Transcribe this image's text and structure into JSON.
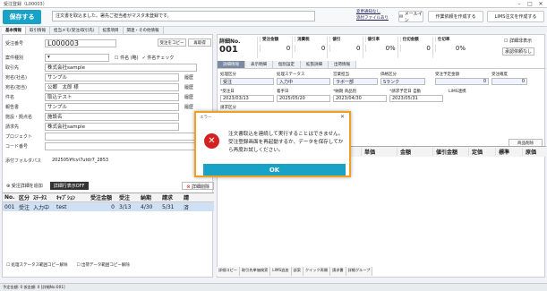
{
  "window": {
    "title": "受注登録（L00003）",
    "min": "–",
    "max": "□",
    "close": "✕"
  },
  "toolbar": {
    "save_label": "保存する",
    "message": "注文書を取込ました。署先ご担当者がマスタ未登録です。",
    "link1": "変更通知なし",
    "link2": "添付ファイルあり",
    "mail_label": "メールイン",
    "btn_create_work": "作業依頼を作成する",
    "btn_create_lims": "LIMS注文を作成する"
  },
  "main_tabs": [
    "基本情報",
    "取引情報",
    "担当メモ(受注/取引先)",
    "拡張項目",
    "関連・その他情報"
  ],
  "form": {
    "order_no_label": "受注番号",
    "order_no": "L000003",
    "copy_btn": "受注をコピー",
    "reissue_btn": "再取得",
    "case_label": "案件種別",
    "name_check": "件名 (略)",
    "name_btn": "件名チェック",
    "customer_label": "取引先",
    "customer_value": "株式会社sample",
    "attn_label": "宛名(社名)",
    "attn_value": "サンプル",
    "person_label": "宛名(担当)",
    "person_value": "公郷　太郎 様",
    "history": "履歴",
    "subject_label": "件名",
    "subject_value": "取込テスト",
    "report_label": "報告書",
    "report_value": "サンプル",
    "facility_label": "施設・拠点名",
    "facility_value": "施設名",
    "billing_label": "請求先",
    "billing_value": "株式会社sample",
    "project_label": "プロジェクト",
    "code_label": "コード番号",
    "attach_label": "添付フォルダパス",
    "attach_value": "202505¥fcvi7utdr7_2853"
  },
  "left_tabs": {
    "add": "受注詳細を追加",
    "show_off": "詳細行表示OFF",
    "delete": "詳細削除"
  },
  "left_grid": {
    "headers": [
      "No.",
      "区分",
      "ｽﾃｰﾀｽ",
      "ｷｬﾌﾟｼｮﾝ",
      "受注金額",
      "受注",
      "納期",
      "請求",
      "請"
    ],
    "rows": [
      [
        "001",
        "受注",
        "入力中",
        "test",
        "0",
        "3/13",
        "4/30",
        "5/31",
        "済"
      ]
    ]
  },
  "left_footer": {
    "check1": "処理ステータス範囲コピー解除",
    "check2": "出荷データ範囲コピー解除"
  },
  "detail": {
    "no_label": "詳細No.",
    "no_value": "001",
    "sum_headers": [
      "受注金額",
      "消費税",
      "値引",
      "値引率",
      "仕切金額",
      "仕切率"
    ],
    "sum_values": [
      "0",
      "0",
      "0",
      "0%",
      "0",
      "0%"
    ],
    "hide_label": "詳細非表示",
    "approve_label": "承認依頼なし"
  },
  "right_tabs": [
    "詳細情報",
    "表示明細",
    "個別設定",
    "拡張詳細",
    "出荷情報"
  ],
  "detail_fields": {
    "kubun_label": "処理区分",
    "kubun_value": "受注",
    "status_label": "処理ステータス",
    "status_value": "入力中",
    "sales_label": "営業担当",
    "sales_value": "ラボ一部",
    "price_label": "価格区分",
    "price_value": "Sランク",
    "due_label": "受注予定金額",
    "due_value": "0",
    "confirm_label": "受注確度",
    "confirm_value": "0",
    "order_date_label": "*受注日",
    "order_date_value": "2023/03/13",
    "start_label": "着手日",
    "start_value": "2025/05/20",
    "deliver_label": "*納期",
    "deliver_value": "2023/04/30",
    "product_label": "商品別",
    "bill_label": "*請求予定日",
    "bill_value": "2023/05/31",
    "auto": "自動",
    "lims": "LIMS連携",
    "report_label": "請求区分",
    "item_btn": "商品削除"
  },
  "right_grid": {
    "headers": [
      "単位",
      "単価",
      "金額",
      "値引金額",
      "定価",
      "標準",
      "原価"
    ]
  },
  "right_bottom": [
    "詳細コピー",
    "取引先単価検索",
    "LIMS追加",
    "部案",
    "クイック再開",
    "請求書",
    "詳細グループ"
  ],
  "dialog": {
    "title": "エラー",
    "message": "注文書取込を連続して実行することはできません。受注登録画面を再起動するか、データを保存してから再度お試しください。",
    "ok": "OK"
  },
  "status": "予定金額: 0 仮金額: 0 [詳細No:001]"
}
